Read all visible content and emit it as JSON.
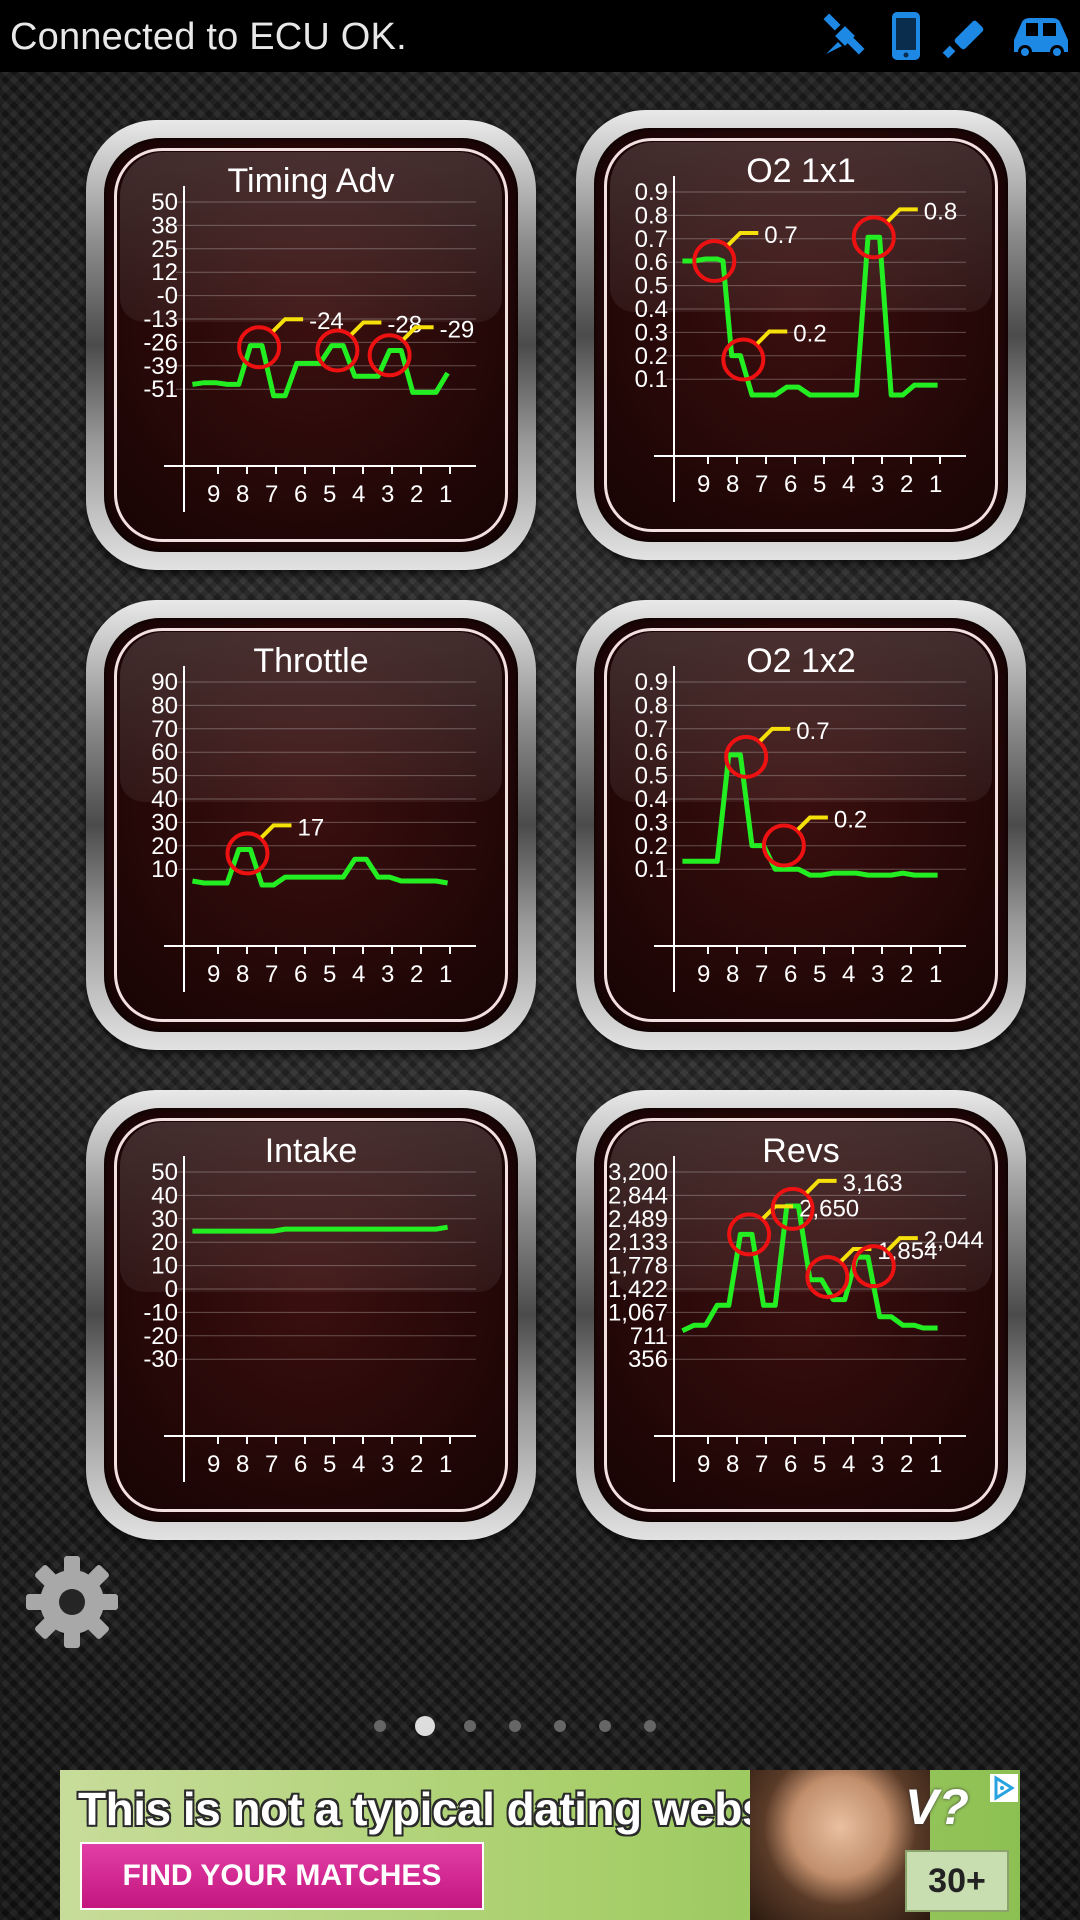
{
  "status_bar": {
    "text": "Connected to ECU OK.",
    "icons": [
      "satellite-icon",
      "phone-icon",
      "dongle-icon",
      "car-icon"
    ],
    "icon_color": "#1e88e5"
  },
  "colors": {
    "trace": "#22ee22",
    "marker_ring": "#ee1111",
    "marker_flag": "#f5e00a"
  },
  "x_ticks": [
    "9",
    "8",
    "7",
    "6",
    "5",
    "4",
    "3",
    "2",
    "1"
  ],
  "gauges": [
    {
      "id": "timing-adv",
      "title": "Timing Adv",
      "ticks": [
        "50",
        "38",
        "25",
        "12",
        "-0",
        "-13",
        "-26",
        "-39",
        "-51"
      ],
      "ymin": -60,
      "ymax": 56,
      "trace": [
        [
          -0.4,
          -57
        ],
        [
          0,
          -56
        ],
        [
          0.4,
          -56
        ],
        [
          0.8,
          -57
        ],
        [
          1.2,
          -57
        ],
        [
          1.6,
          -33
        ],
        [
          2,
          -33
        ],
        [
          2.4,
          -64
        ],
        [
          2.8,
          -64
        ],
        [
          3.2,
          -44
        ],
        [
          3.6,
          -44
        ],
        [
          4,
          -44
        ],
        [
          4.4,
          -33
        ],
        [
          4.8,
          -33
        ],
        [
          5.2,
          -52
        ],
        [
          5.6,
          -52
        ],
        [
          6,
          -52
        ],
        [
          6.4,
          -36
        ],
        [
          6.8,
          -36
        ],
        [
          7.2,
          -62
        ],
        [
          7.6,
          -62
        ],
        [
          8,
          -62
        ],
        [
          8.4,
          -50
        ]
      ],
      "markers": [
        {
          "x": 1.9,
          "y": -34,
          "label": "-24"
        },
        {
          "x": 4.6,
          "y": -36,
          "label": "-28"
        },
        {
          "x": 6.4,
          "y": -39,
          "label": "-29"
        }
      ]
    },
    {
      "id": "o2-1x1",
      "title": "O2 1x1",
      "ticks": [
        "0.9",
        "0.8",
        "0.7",
        "0.6",
        "0.5",
        "0.4",
        "0.3",
        "0.2",
        "0.1"
      ],
      "ymin": 0,
      "ymax": 0.95,
      "trace": [
        [
          -0.4,
          0.6
        ],
        [
          0,
          0.6
        ],
        [
          0.4,
          0.61
        ],
        [
          0.8,
          0.61
        ],
        [
          1,
          0.6
        ],
        [
          1.3,
          0.12
        ],
        [
          1.6,
          0.12
        ],
        [
          2,
          -0.08
        ],
        [
          2.4,
          -0.08
        ],
        [
          2.8,
          -0.08
        ],
        [
          3.2,
          -0.04
        ],
        [
          3.6,
          -0.04
        ],
        [
          4,
          -0.08
        ],
        [
          4.4,
          -0.08
        ],
        [
          4.8,
          -0.08
        ],
        [
          5.2,
          -0.08
        ],
        [
          5.6,
          -0.08
        ],
        [
          6,
          0.72
        ],
        [
          6.4,
          0.72
        ],
        [
          6.8,
          -0.08
        ],
        [
          7.2,
          -0.08
        ],
        [
          7.6,
          -0.03
        ],
        [
          8,
          -0.03
        ],
        [
          8.4,
          -0.03
        ]
      ],
      "markers": [
        {
          "x": 0.7,
          "y": 0.6,
          "label": "0.7"
        },
        {
          "x": 1.7,
          "y": 0.1,
          "label": "0.2"
        },
        {
          "x": 6.2,
          "y": 0.72,
          "label": "0.8"
        }
      ]
    },
    {
      "id": "throttle",
      "title": "Throttle",
      "ticks": [
        "90",
        "80",
        "70",
        "60",
        "50",
        "40",
        "30",
        "20",
        "10"
      ],
      "ymin": 0,
      "ymax": 95,
      "trace": [
        [
          -0.4,
          -6
        ],
        [
          0,
          -7
        ],
        [
          0.4,
          -7
        ],
        [
          0.8,
          -7
        ],
        [
          1.2,
          10
        ],
        [
          1.6,
          10
        ],
        [
          2,
          -8
        ],
        [
          2.4,
          -8
        ],
        [
          2.8,
          -4
        ],
        [
          3.2,
          -4
        ],
        [
          3.6,
          -4
        ],
        [
          4,
          -4
        ],
        [
          4.4,
          -4
        ],
        [
          4.8,
          -4
        ],
        [
          5.2,
          5
        ],
        [
          5.6,
          5
        ],
        [
          6,
          -4
        ],
        [
          6.4,
          -4
        ],
        [
          6.8,
          -6
        ],
        [
          7.2,
          -6
        ],
        [
          7.6,
          -6
        ],
        [
          8,
          -6
        ],
        [
          8.4,
          -7
        ]
      ],
      "markers": [
        {
          "x": 1.5,
          "y": 8,
          "label": "17"
        }
      ]
    },
    {
      "id": "o2-1x2",
      "title": "O2 1x2",
      "ticks": [
        "0.9",
        "0.8",
        "0.7",
        "0.6",
        "0.5",
        "0.4",
        "0.3",
        "0.2",
        "0.1"
      ],
      "ymin": 0,
      "ymax": 0.95,
      "trace": [
        [
          -0.4,
          0.04
        ],
        [
          0,
          0.04
        ],
        [
          0.4,
          0.04
        ],
        [
          0.8,
          0.04
        ],
        [
          1.2,
          0.58
        ],
        [
          1.6,
          0.58
        ],
        [
          2,
          0.12
        ],
        [
          2.4,
          0.12
        ],
        [
          2.8,
          0.0
        ],
        [
          3.2,
          0.0
        ],
        [
          3.6,
          0.0
        ],
        [
          4,
          -0.03
        ],
        [
          4.4,
          -0.03
        ],
        [
          4.8,
          -0.02
        ],
        [
          5.2,
          -0.02
        ],
        [
          5.6,
          -0.02
        ],
        [
          6,
          -0.03
        ],
        [
          6.4,
          -0.03
        ],
        [
          6.8,
          -0.03
        ],
        [
          7.2,
          -0.02
        ],
        [
          7.6,
          -0.03
        ],
        [
          8,
          -0.03
        ],
        [
          8.4,
          -0.03
        ]
      ],
      "markers": [
        {
          "x": 1.8,
          "y": 0.57,
          "label": "0.7"
        },
        {
          "x": 3.1,
          "y": 0.12,
          "label": "0.2"
        }
      ]
    },
    {
      "id": "intake",
      "title": "Intake",
      "ticks": [
        "50",
        "40",
        "30",
        "20",
        "10",
        "0",
        "-10",
        "-20",
        "-30"
      ],
      "ymin": -40,
      "ymax": 55,
      "trace": [
        [
          -0.4,
          25
        ],
        [
          0,
          25
        ],
        [
          0.4,
          25
        ],
        [
          0.8,
          25
        ],
        [
          1.2,
          25
        ],
        [
          1.6,
          25
        ],
        [
          2,
          25
        ],
        [
          2.4,
          25
        ],
        [
          2.8,
          26
        ],
        [
          3.2,
          26
        ],
        [
          3.6,
          26
        ],
        [
          4,
          26
        ],
        [
          4.4,
          26
        ],
        [
          4.8,
          26
        ],
        [
          5.2,
          26
        ],
        [
          5.6,
          26
        ],
        [
          6,
          26
        ],
        [
          6.4,
          26
        ],
        [
          6.8,
          26
        ],
        [
          7.2,
          26
        ],
        [
          7.6,
          26
        ],
        [
          8,
          26
        ],
        [
          8.4,
          27
        ]
      ],
      "markers": []
    },
    {
      "id": "revs",
      "title": "Revs",
      "ticks": [
        "3,200",
        "2,844",
        "2,489",
        "2,133",
        "1,778",
        "1,422",
        "1,067",
        "711",
        "356"
      ],
      "ymin": 0,
      "ymax": 3300,
      "trace": [
        [
          -0.4,
          500
        ],
        [
          0,
          600
        ],
        [
          0.4,
          600
        ],
        [
          0.8,
          950
        ],
        [
          1.2,
          950
        ],
        [
          1.6,
          2200
        ],
        [
          2,
          2200
        ],
        [
          2.4,
          950
        ],
        [
          2.8,
          950
        ],
        [
          3.2,
          2700
        ],
        [
          3.6,
          2700
        ],
        [
          4,
          1400
        ],
        [
          4.4,
          1400
        ],
        [
          4.8,
          1050
        ],
        [
          5.2,
          1050
        ],
        [
          5.6,
          1800
        ],
        [
          6,
          1800
        ],
        [
          6.4,
          750
        ],
        [
          6.8,
          750
        ],
        [
          7.2,
          600
        ],
        [
          7.6,
          600
        ],
        [
          7.9,
          550
        ],
        [
          8.4,
          550
        ]
      ],
      "markers": [
        {
          "x": 1.9,
          "y": 2200,
          "label": "2,650"
        },
        {
          "x": 3.4,
          "y": 2650,
          "label": "3,163"
        },
        {
          "x": 4.6,
          "y": 1450,
          "label": "1,854"
        },
        {
          "x": 6.2,
          "y": 1640,
          "label": "2,044"
        }
      ]
    }
  ],
  "page_indicator": {
    "count": 7,
    "active": 1
  },
  "ad": {
    "headline": "This is not a typical  dating  website!",
    "cta": "FIND YOUR MATCHES",
    "logo": "V?",
    "age": "30+"
  }
}
